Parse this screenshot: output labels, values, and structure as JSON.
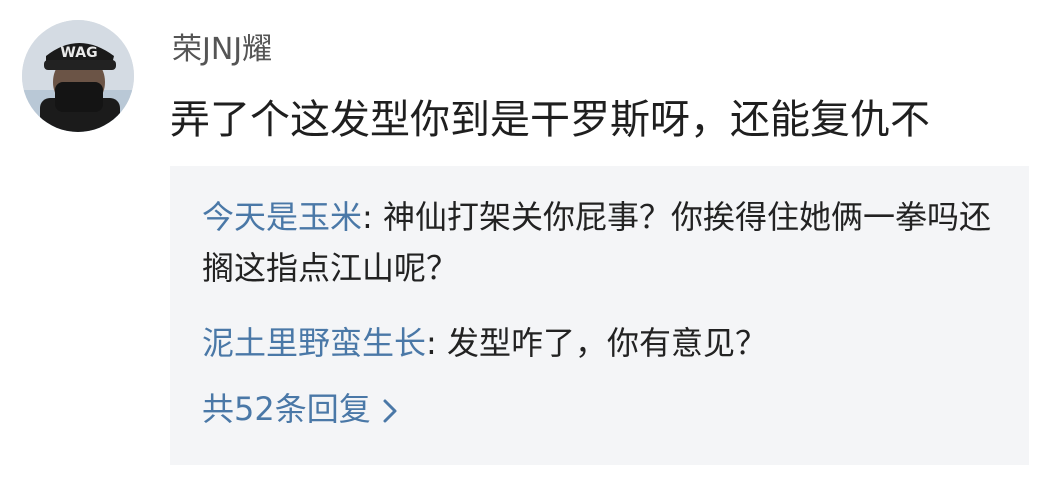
{
  "comment": {
    "username": "荣JNJ耀",
    "text": "弄了个这发型你到是干罗斯呀，还能复仇不"
  },
  "replies": [
    {
      "author": "今天是玉米",
      "separator": ": ",
      "text": "神仙打架关你屁事？你挨得住她俩一拳吗还搁这指点江山呢？"
    },
    {
      "author": "泥土里野蛮生长",
      "separator": ": ",
      "text": "发型咋了，你有意见？"
    }
  ],
  "more_replies": {
    "label": "共52条回复"
  },
  "icons": {
    "more": "chevron-right-icon",
    "avatar": "user-avatar"
  },
  "colors": {
    "link": "#4a78a7",
    "reply_bg": "#f4f5f7",
    "username": "#555555"
  }
}
